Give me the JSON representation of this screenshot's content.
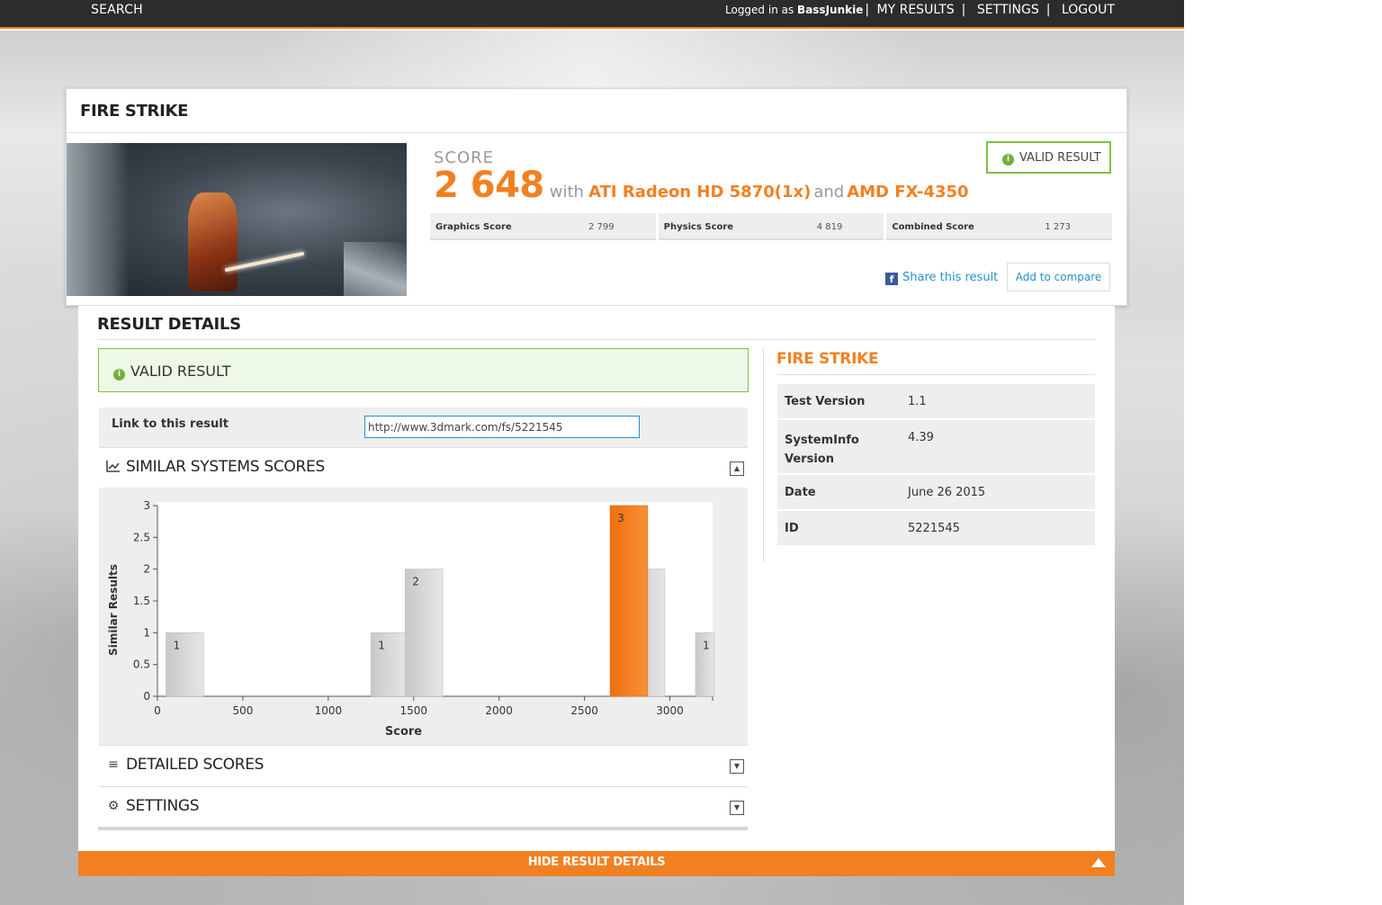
{
  "topbar": {
    "search": "SEARCH",
    "logged_in_prefix": "Logged in as ",
    "username": "BassJunkie",
    "my_results": "MY RESULTS",
    "settings": "SETTINGS",
    "logout": "LOGOUT",
    "separator": "|"
  },
  "result": {
    "title": "FIRE STRIKE",
    "score_label": "SCORE",
    "score": "2 648",
    "with": "with",
    "gpu": "ATI Radeon HD 5870(1x)",
    "and": "and",
    "cpu": "AMD FX-4350",
    "valid_badge": "VALID RESULT",
    "subscores": [
      {
        "label": "Graphics Score",
        "value": "2 799"
      },
      {
        "label": "Physics Score",
        "value": "4 819"
      },
      {
        "label": "Combined Score",
        "value": "1 273"
      }
    ],
    "share": "Share this result",
    "compare": "Add to compare"
  },
  "details": {
    "header": "RESULT DETAILS",
    "valid": "VALID RESULT",
    "link_label": "Link to this result",
    "link_value": "http://www.3dmark.com/fs/5221545",
    "similar_title": "SIMILAR SYSTEMS SCORES",
    "detailed_title": "DETAILED SCORES",
    "settings_title": "SETTINGS",
    "hide": "HIDE RESULT DETAILS"
  },
  "test_info": {
    "title": "FIRE STRIKE",
    "rows": [
      {
        "key": "Test Version",
        "value": "1.1"
      },
      {
        "key": "SystemInfo Version",
        "value": "4.39"
      },
      {
        "key": "Date",
        "value": "June 26 2015"
      },
      {
        "key": "ID",
        "value": "5221545"
      }
    ]
  },
  "colors": {
    "accent": "#f28021",
    "valid_green": "#7dc243",
    "link_blue": "#2b8fc9",
    "bar_gray": "#dcdcdc"
  },
  "icons": {
    "info": "info-icon",
    "facebook": "facebook-icon",
    "chart": "line-chart-icon",
    "list": "list-icon",
    "gear": "gear-icon",
    "collapse": "collapse-icon",
    "expand": "expand-icon",
    "hide": "triangle-up-icon"
  },
  "chart_data": {
    "type": "bar",
    "xlabel": "Score",
    "ylabel": "Similar Results",
    "xlim": [
      0,
      3250
    ],
    "ylim": [
      0,
      3
    ],
    "x_ticks": [
      "0",
      "500",
      "1000",
      "1500",
      "2000",
      "2500",
      "3000"
    ],
    "y_ticks": [
      "0",
      "0.5",
      "1",
      "1.5",
      "2",
      "2.5",
      "3"
    ],
    "bins": [
      {
        "from": 50,
        "to": 270,
        "value": 1,
        "label": "1",
        "highlight": false
      },
      {
        "from": 1250,
        "to": 1450,
        "value": 1,
        "label": "1",
        "highlight": false
      },
      {
        "from": 1450,
        "to": 1670,
        "value": 2,
        "label": "2",
        "highlight": false
      },
      {
        "from": 2650,
        "to": 2870,
        "value": 3,
        "label": "3",
        "highlight": true
      },
      {
        "from": 2750,
        "to": 2970,
        "value": 2,
        "label": "2",
        "highlight": false
      },
      {
        "from": 3150,
        "to": 3370,
        "value": 1,
        "label": "1",
        "highlight": false
      }
    ]
  }
}
